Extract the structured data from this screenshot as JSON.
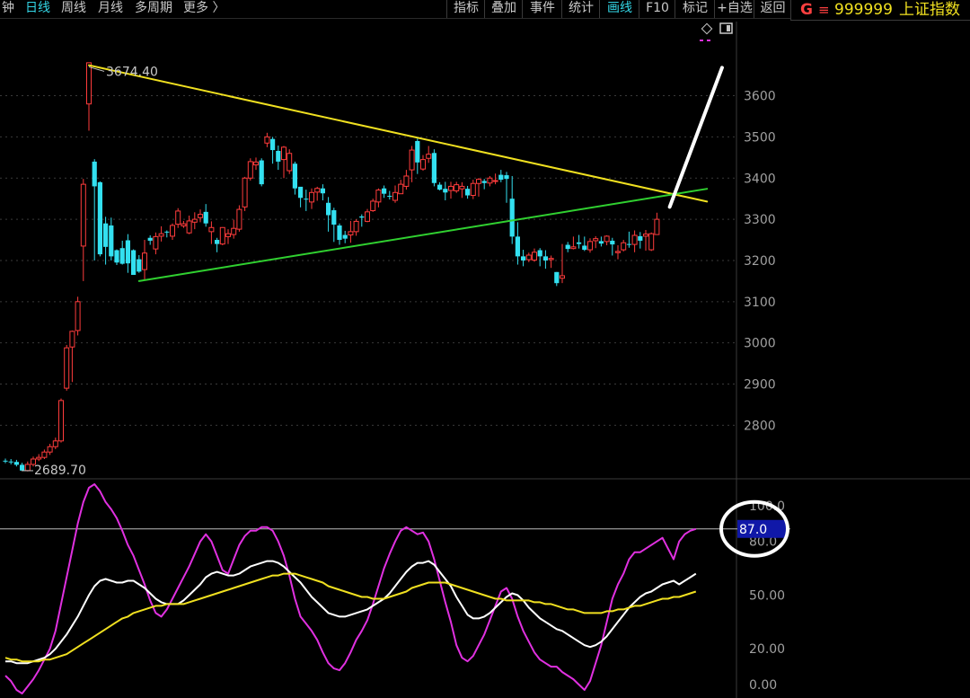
{
  "toolbar": {
    "tabs": [
      "钟",
      "日线",
      "周线",
      "月线",
      "多周期",
      "更多 〉"
    ],
    "active_tab": "日线",
    "buttons": [
      "指标",
      "叠加",
      "事件",
      "统计",
      "画线",
      "F10",
      "标记",
      "+自选",
      "返回"
    ],
    "active_button": "画线"
  },
  "stock": {
    "g_label": "G",
    "eq_label": "≡",
    "code": "999999",
    "name": "上证指数"
  },
  "colors": {
    "up": "#ff3c3c",
    "down": "#33e0f0",
    "yellow": "#f0e020",
    "green": "#30d030",
    "magenta": "#e030e0",
    "white": "#ffffff",
    "badge": "#1018a8"
  },
  "chart_data": [
    {
      "type": "candlestick",
      "title": "上证指数",
      "y_ticks": [
        3600,
        3500,
        3400,
        3300,
        3200,
        3100,
        3000,
        2900,
        2800
      ],
      "ylim": [
        2670,
        3780
      ],
      "annotations": {
        "high_label": "3674.40",
        "low_label": "2689.70",
        "high": 3674.4,
        "low": 2689.7
      },
      "grid": true,
      "candles": [
        [
          2714,
          2712,
          2719,
          2708
        ],
        [
          2712,
          2711,
          2718,
          2705
        ],
        [
          2711,
          2704,
          2716,
          2700
        ],
        [
          2704,
          2690,
          2709,
          2690
        ],
        [
          2690,
          2705,
          2712,
          2688
        ],
        [
          2705,
          2718,
          2724,
          2700
        ],
        [
          2718,
          2722,
          2730,
          2713
        ],
        [
          2722,
          2735,
          2741,
          2718
        ],
        [
          2735,
          2748,
          2755,
          2728
        ],
        [
          2748,
          2762,
          2770,
          2742
        ],
        [
          2762,
          2860,
          2865,
          2758
        ],
        [
          2890,
          2988,
          2995,
          2884
        ],
        [
          2990,
          3028,
          3030,
          2905
        ],
        [
          3030,
          3100,
          3112,
          3018
        ],
        [
          3235,
          3385,
          3398,
          3150
        ],
        [
          3580,
          3680,
          3680,
          3515
        ],
        [
          3440,
          3380,
          3446,
          3200
        ],
        [
          3390,
          3215,
          3392,
          3210
        ],
        [
          3290,
          3233,
          3306,
          3190
        ],
        [
          3285,
          3210,
          3304,
          3200
        ],
        [
          3225,
          3195,
          3227,
          3189
        ],
        [
          3230,
          3192,
          3248,
          3190
        ],
        [
          3249,
          3193,
          3264,
          3170
        ],
        [
          3225,
          3165,
          3227,
          3180
        ],
        [
          3203,
          3173,
          3213,
          3170
        ],
        [
          3178,
          3218,
          3250,
          3154
        ],
        [
          3255,
          3248,
          3261,
          3238
        ],
        [
          3228,
          3258,
          3268,
          3215
        ],
        [
          3259,
          3265,
          3283,
          3246
        ],
        [
          3270,
          3268,
          3273,
          3256
        ],
        [
          3259,
          3285,
          3290,
          3250
        ],
        [
          3288,
          3320,
          3327,
          3279
        ],
        [
          3284,
          3289,
          3296,
          3279
        ],
        [
          3267,
          3296,
          3309,
          3264
        ],
        [
          3293,
          3300,
          3317,
          3276
        ],
        [
          3304,
          3312,
          3324,
          3293
        ],
        [
          3318,
          3290,
          3337,
          3282
        ],
        [
          3270,
          3280,
          3295,
          3240
        ],
        [
          3250,
          3240,
          3255,
          3220
        ],
        [
          3240,
          3280,
          3281,
          3237
        ],
        [
          3258,
          3265,
          3276,
          3240
        ],
        [
          3263,
          3278,
          3299,
          3253
        ],
        [
          3276,
          3324,
          3334,
          3270
        ],
        [
          3330,
          3400,
          3403,
          3320
        ],
        [
          3400,
          3440,
          3448,
          3394
        ],
        [
          3432,
          3439,
          3450,
          3420
        ],
        [
          3443,
          3385,
          3448,
          3380
        ],
        [
          3485,
          3500,
          3510,
          3475
        ],
        [
          3495,
          3468,
          3500,
          3435
        ],
        [
          3466,
          3440,
          3479,
          3420
        ],
        [
          3445,
          3475,
          3478,
          3400
        ],
        [
          3418,
          3460,
          3470,
          3410
        ],
        [
          3435,
          3375,
          3440,
          3360
        ],
        [
          3379,
          3352,
          3378,
          3329
        ],
        [
          3350,
          3348,
          3372,
          3320
        ],
        [
          3342,
          3365,
          3375,
          3325
        ],
        [
          3366,
          3375,
          3379,
          3345
        ],
        [
          3375,
          3363,
          3385,
          3346
        ],
        [
          3340,
          3310,
          3354,
          3270
        ],
        [
          3322,
          3287,
          3328,
          3245
        ],
        [
          3285,
          3250,
          3290,
          3238
        ],
        [
          3262,
          3253,
          3272,
          3242
        ],
        [
          3262,
          3270,
          3296,
          3243
        ],
        [
          3270,
          3295,
          3300,
          3260
        ],
        [
          3307,
          3304,
          3312,
          3282
        ],
        [
          3295,
          3318,
          3325,
          3293
        ],
        [
          3321,
          3344,
          3350,
          3318
        ],
        [
          3342,
          3371,
          3375,
          3329
        ],
        [
          3375,
          3362,
          3382,
          3352
        ],
        [
          3357,
          3355,
          3369,
          3348
        ],
        [
          3346,
          3365,
          3382,
          3340
        ],
        [
          3362,
          3385,
          3396,
          3362
        ],
        [
          3380,
          3405,
          3420,
          3372
        ],
        [
          3420,
          3468,
          3478,
          3390
        ],
        [
          3490,
          3438,
          3496,
          3410
        ],
        [
          3422,
          3445,
          3456,
          3418
        ],
        [
          3448,
          3458,
          3478,
          3437
        ],
        [
          3461,
          3388,
          3470,
          3380
        ],
        [
          3384,
          3372,
          3390,
          3370
        ],
        [
          3374,
          3365,
          3391,
          3346
        ],
        [
          3370,
          3380,
          3391,
          3350
        ],
        [
          3369,
          3384,
          3391,
          3364
        ],
        [
          3374,
          3380,
          3390,
          3352
        ],
        [
          3374,
          3358,
          3381,
          3350
        ],
        [
          3358,
          3387,
          3396,
          3349
        ],
        [
          3387,
          3397,
          3400,
          3355
        ],
        [
          3393,
          3388,
          3398,
          3373
        ],
        [
          3388,
          3400,
          3405,
          3380
        ],
        [
          3394,
          3394,
          3411,
          3385
        ],
        [
          3408,
          3396,
          3420,
          3390
        ],
        [
          3407,
          3398,
          3415,
          3340
        ],
        [
          3350,
          3258,
          3405,
          3240
        ],
        [
          3258,
          3210,
          3293,
          3190
        ],
        [
          3210,
          3200,
          3226,
          3186
        ],
        [
          3202,
          3213,
          3219,
          3196
        ],
        [
          3201,
          3220,
          3229,
          3197
        ],
        [
          3225,
          3210,
          3230,
          3186
        ],
        [
          3210,
          3200,
          3225,
          3180
        ],
        [
          3202,
          3205,
          3212,
          3182
        ],
        [
          3172,
          3145,
          3172,
          3138
        ],
        [
          3157,
          3163,
          3240,
          3145
        ],
        [
          3238,
          3228,
          3245,
          3220
        ],
        [
          3229,
          3233,
          3258,
          3227
        ],
        [
          3244,
          3240,
          3262,
          3229
        ],
        [
          3236,
          3226,
          3258,
          3223
        ],
        [
          3226,
          3246,
          3254,
          3219
        ],
        [
          3248,
          3253,
          3259,
          3230
        ],
        [
          3247,
          3241,
          3258,
          3234
        ],
        [
          3246,
          3259,
          3261,
          3237
        ],
        [
          3248,
          3239,
          3255,
          3212
        ],
        [
          3219,
          3222,
          3237,
          3203
        ],
        [
          3226,
          3243,
          3250,
          3222
        ],
        [
          3240,
          3238,
          3270,
          3231
        ],
        [
          3239,
          3261,
          3273,
          3220
        ],
        [
          3259,
          3248,
          3269,
          3229
        ],
        [
          3259,
          3264,
          3274,
          3224
        ],
        [
          3226,
          3265,
          3268,
          3223
        ],
        [
          3263,
          3300,
          3316,
          3262
        ]
      ],
      "trendlines": [
        {
          "name": "upper",
          "color": "yellow",
          "from": [
            15,
            3674
          ],
          "to": [
            126,
            3343
          ]
        },
        {
          "name": "lower",
          "color": "green",
          "from": [
            24,
            3150
          ],
          "to": [
            126,
            3374
          ]
        },
        {
          "name": "arrow",
          "color": "white",
          "from": [
            119.3,
            3330
          ],
          "to": [
            128.7,
            3668
          ]
        }
      ]
    },
    {
      "type": "line",
      "title": "",
      "y_ticks": [
        100,
        80,
        50,
        20,
        0
      ],
      "y_tick_labels": [
        "100.0",
        "80.0",
        "50.00",
        "20.00",
        "0.00"
      ],
      "ylim": [
        -7.5,
        115
      ],
      "current_value_label": "87.0",
      "reference_line": 87,
      "series": [
        {
          "color": "magenta",
          "values": [
            5,
            2,
            -3,
            -5,
            -1,
            3,
            8,
            14,
            20,
            30,
            45,
            60,
            75,
            90,
            102,
            110,
            112,
            108,
            102,
            98,
            93,
            86,
            78,
            72,
            64,
            56,
            47,
            40,
            38,
            42,
            48,
            54,
            60,
            66,
            73,
            80,
            84,
            80,
            72,
            64,
            62,
            70,
            78,
            83,
            86,
            86,
            88,
            88,
            86,
            80,
            72,
            61,
            48,
            38,
            34,
            30,
            25,
            18,
            12,
            9,
            8,
            12,
            18,
            25,
            30,
            36,
            45,
            55,
            65,
            73,
            80,
            86,
            88,
            86,
            84,
            85,
            80,
            70,
            58,
            46,
            35,
            22,
            15,
            13,
            16,
            22,
            28,
            36,
            44,
            52,
            54,
            48,
            38,
            30,
            24,
            18,
            14,
            12,
            10,
            10,
            7,
            5,
            3,
            0,
            -3,
            2,
            12,
            22,
            35,
            48,
            56,
            62,
            70,
            74,
            74,
            76,
            78,
            80,
            82,
            76,
            70,
            80,
            84,
            86,
            87
          ]
        },
        {
          "color": "white",
          "values": [
            13,
            13,
            12,
            12,
            12,
            13,
            14,
            15,
            17,
            20,
            24,
            28,
            33,
            38,
            44,
            50,
            55,
            58,
            59,
            58,
            57,
            57,
            58,
            58,
            56,
            54,
            51,
            48,
            46,
            45,
            45,
            45,
            47,
            50,
            53,
            56,
            60,
            62,
            63,
            62,
            61,
            61,
            62,
            64,
            66,
            67,
            68,
            69,
            69,
            68,
            66,
            63,
            60,
            57,
            53,
            49,
            46,
            43,
            40,
            39,
            38,
            38,
            39,
            40,
            41,
            42,
            44,
            46,
            48,
            51,
            55,
            59,
            63,
            66,
            68,
            68,
            69,
            67,
            63,
            59,
            55,
            49,
            44,
            39,
            37,
            37,
            38,
            40,
            43,
            46,
            49,
            51,
            50,
            47,
            43,
            40,
            37,
            35,
            33,
            31,
            30,
            28,
            26,
            24,
            22,
            21,
            22,
            24,
            27,
            31,
            35,
            39,
            43,
            46,
            49,
            51,
            52,
            54,
            56,
            57,
            58,
            56,
            58,
            60,
            62
          ]
        },
        {
          "color": "yellow",
          "values": [
            15,
            14,
            14,
            13,
            13,
            13,
            13,
            14,
            14,
            15,
            16,
            17,
            19,
            21,
            23,
            25,
            27,
            29,
            31,
            33,
            35,
            37,
            38,
            40,
            41,
            42,
            43,
            44,
            44,
            45,
            45,
            45,
            45,
            46,
            47,
            48,
            49,
            50,
            51,
            52,
            53,
            54,
            55,
            56,
            57,
            58,
            59,
            60,
            61,
            61,
            62,
            62,
            62,
            61,
            60,
            59,
            58,
            57,
            55,
            54,
            53,
            52,
            51,
            50,
            49,
            49,
            48,
            48,
            48,
            49,
            50,
            51,
            52,
            54,
            55,
            56,
            57,
            57,
            57,
            57,
            56,
            55,
            54,
            53,
            52,
            51,
            50,
            49,
            48,
            48,
            47,
            47,
            47,
            47,
            47,
            46,
            46,
            45,
            45,
            44,
            43,
            42,
            42,
            41,
            40,
            40,
            40,
            40,
            41,
            41,
            42,
            42,
            43,
            44,
            44,
            45,
            46,
            47,
            48,
            48,
            49,
            49,
            50,
            51,
            52
          ]
        }
      ]
    }
  ]
}
